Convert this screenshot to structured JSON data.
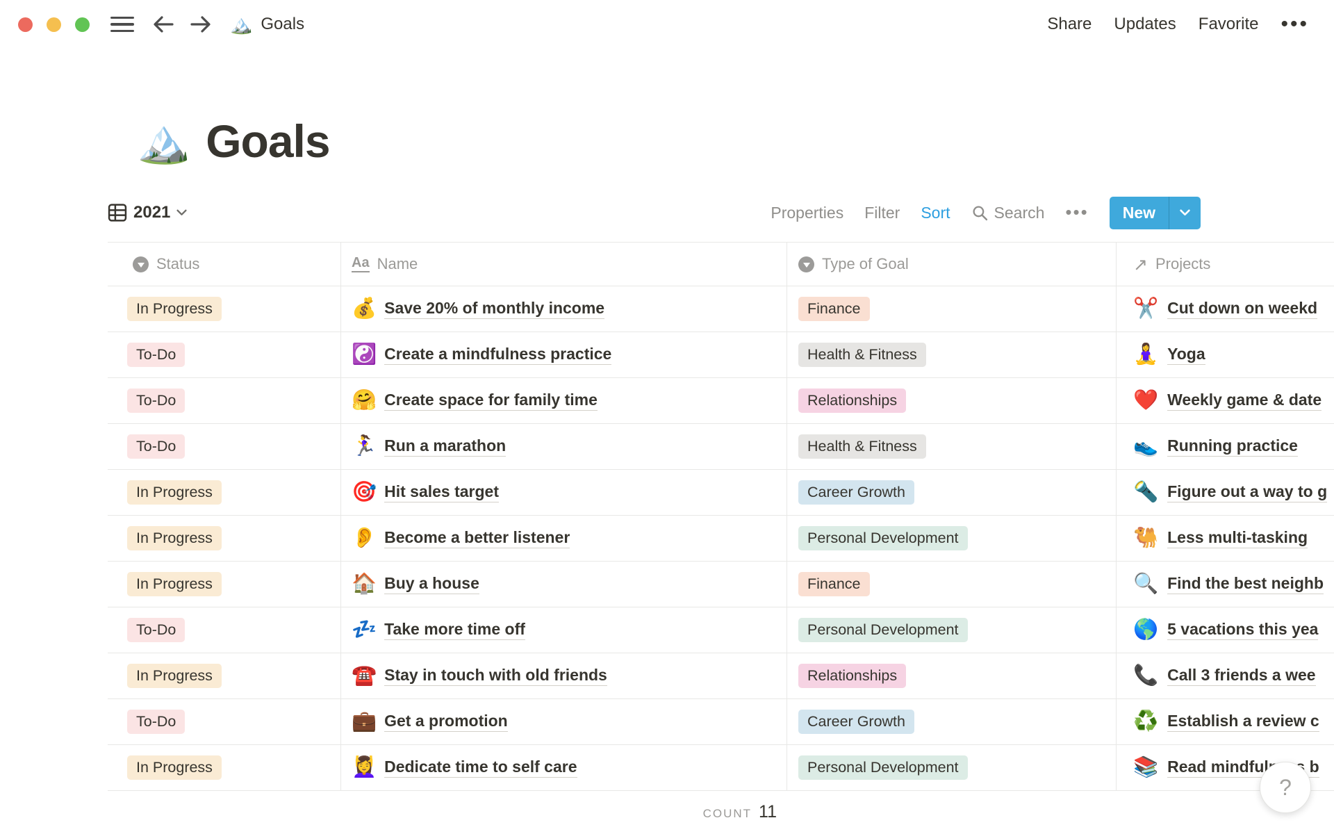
{
  "topbar": {
    "breadcrumb_icon": "🏔️",
    "breadcrumb_title": "Goals",
    "share_label": "Share",
    "updates_label": "Updates",
    "favorite_label": "Favorite",
    "more_label": "•••"
  },
  "page": {
    "icon": "🏔️",
    "title": "Goals"
  },
  "toolbar": {
    "view_name": "2021",
    "properties_label": "Properties",
    "filter_label": "Filter",
    "sort_label": "Sort",
    "search_label": "Search",
    "more_label": "•••",
    "new_label": "New"
  },
  "table": {
    "headers": {
      "status": "Status",
      "name": "Name",
      "name_icon": "Aa",
      "type": "Type of Goal",
      "projects": "Projects",
      "projects_icon": "↗"
    },
    "rows": [
      {
        "status": "In Progress",
        "status_color": "yellow",
        "name_icon": "💰",
        "name": "Save 20% of monthly income",
        "type": "Finance",
        "type_color": "orange",
        "project_icon": "✂️",
        "project": "Cut down on weekd"
      },
      {
        "status": "To-Do",
        "status_color": "red",
        "name_icon": "☯️",
        "name": "Create a mindfulness practice",
        "type": "Health & Fitness",
        "type_color": "gray",
        "project_icon": "🧘‍♀️",
        "project": "Yoga"
      },
      {
        "status": "To-Do",
        "status_color": "red",
        "name_icon": "🤗",
        "name": "Create space for family time",
        "type": "Relationships",
        "type_color": "pink",
        "project_icon": "❤️",
        "project": "Weekly game & date"
      },
      {
        "status": "To-Do",
        "status_color": "red",
        "name_icon": "🏃‍♀️",
        "name": "Run a marathon",
        "type": "Health & Fitness",
        "type_color": "gray",
        "project_icon": "👟",
        "project": "Running practice"
      },
      {
        "status": "In Progress",
        "status_color": "yellow",
        "name_icon": "🎯",
        "name": "Hit sales target",
        "type": "Career Growth",
        "type_color": "blue",
        "project_icon": "🔦",
        "project": "Figure out a way to g"
      },
      {
        "status": "In Progress",
        "status_color": "yellow",
        "name_icon": "👂",
        "name": "Become a better listener",
        "type": "Personal Development",
        "type_color": "green",
        "project_icon": "🐫",
        "project": "Less multi-tasking"
      },
      {
        "status": "In Progress",
        "status_color": "yellow",
        "name_icon": "🏠",
        "name": "Buy a house",
        "type": "Finance",
        "type_color": "orange",
        "project_icon": "🔍",
        "project": "Find the best neighb"
      },
      {
        "status": "To-Do",
        "status_color": "red",
        "name_icon": "💤",
        "name": "Take more time off",
        "type": "Personal Development",
        "type_color": "green",
        "project_icon": "🌎",
        "project": "5 vacations this yea"
      },
      {
        "status": "In Progress",
        "status_color": "yellow",
        "name_icon": "☎️",
        "name": "Stay in touch with old friends",
        "type": "Relationships",
        "type_color": "pink",
        "project_icon": "📞",
        "project": "Call 3 friends a wee"
      },
      {
        "status": "To-Do",
        "status_color": "red",
        "name_icon": "💼",
        "name": "Get a promotion",
        "type": "Career Growth",
        "type_color": "blue",
        "project_icon": "♻️",
        "project": "Establish a review c"
      },
      {
        "status": "In Progress",
        "status_color": "yellow",
        "name_icon": "💆‍♀️",
        "name": "Dedicate time to self care",
        "type": "Personal Development",
        "type_color": "green",
        "project_icon": "📚",
        "project": "Read mindfulness b"
      }
    ],
    "footer": {
      "count_label": "COUNT",
      "count_value": "11"
    }
  },
  "help": {
    "label": "?"
  },
  "colors": {
    "new_button_blue": "#3FA9DC",
    "sort_active_blue": "#2E9FE0",
    "badge_yellow": "#FAEBD4",
    "badge_red": "#FBE4E4",
    "badge_orange": "#FADFD2",
    "badge_gray": "#E6E5E3",
    "badge_pink": "#F6D3E3",
    "badge_blue": "#D3E5EF",
    "badge_green": "#DCECE5",
    "traffic_red": "#EC6A5E",
    "traffic_yellow": "#F5BF4F",
    "traffic_green": "#61C454"
  }
}
